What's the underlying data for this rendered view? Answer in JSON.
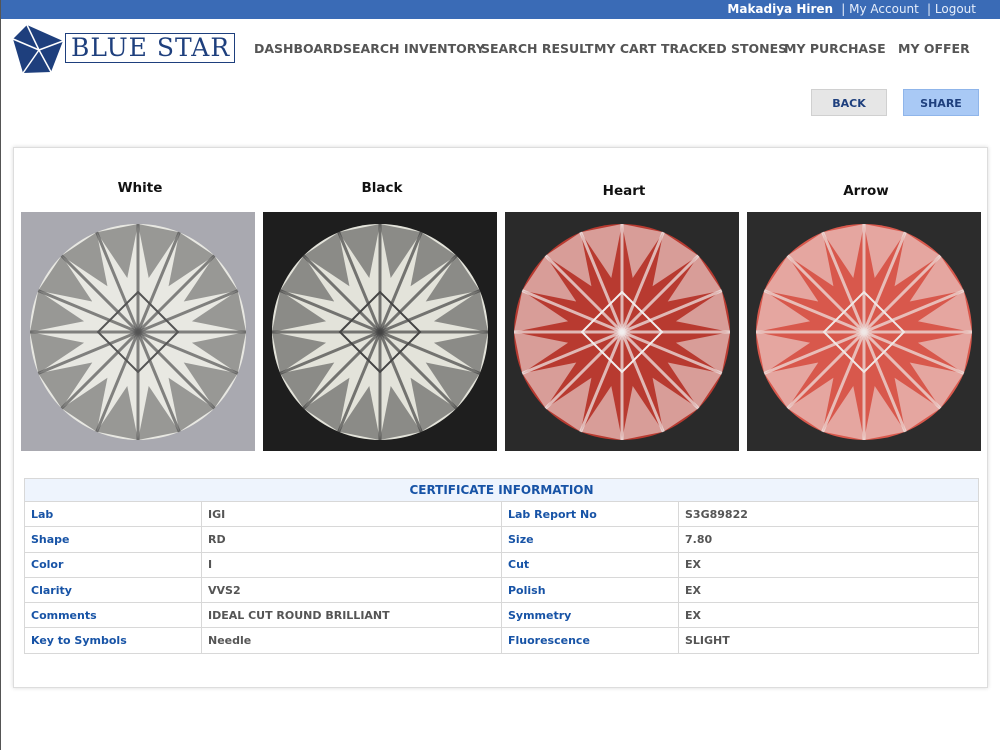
{
  "topbar": {
    "user": "Makadiya Hiren",
    "my_account": "| My Account",
    "logout": "| Logout"
  },
  "logo": {
    "text": "BLUE STAR"
  },
  "nav": [
    "DASHBOARD",
    "SEARCH INVENTORY",
    "SEARCH RESULT",
    "MY CART",
    "TRACKED STONES",
    "MY PURCHASE",
    "MY OFFER"
  ],
  "buttons": {
    "back": "BACK",
    "share": "SHARE"
  },
  "images": [
    {
      "title": "White"
    },
    {
      "title": "Black"
    },
    {
      "title": "Heart"
    },
    {
      "title": "Arrow"
    }
  ],
  "certificate": {
    "title": "CERTIFICATE INFORMATION",
    "rows": [
      [
        "Lab",
        "IGI",
        "Lab Report No",
        "S3G89822"
      ],
      [
        "Shape",
        "RD",
        "Size",
        "7.80"
      ],
      [
        "Color",
        "I",
        "Cut",
        "EX"
      ],
      [
        "Clarity",
        "VVS2",
        "Polish",
        "EX"
      ],
      [
        "Comments",
        "IDEAL CUT ROUND BRILLIANT",
        "Symmetry",
        "EX"
      ],
      [
        "Key to Symbols",
        "Needle",
        "Fluorescence",
        "SLIGHT"
      ]
    ]
  },
  "colors": {
    "topbar": "#3a6bb6",
    "brand": "#1e3f7d",
    "label": "#1753a6"
  }
}
